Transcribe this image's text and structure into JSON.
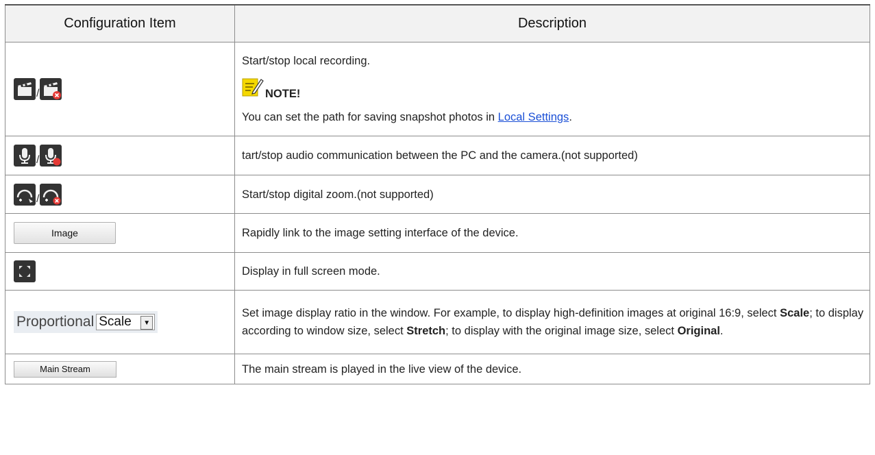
{
  "headers": {
    "col1": "Configuration Item",
    "col2": "Description"
  },
  "rows": [
    {
      "icon_pair": [
        "record-start-icon",
        "record-stop-icon"
      ],
      "line1": "Start/stop local recording.",
      "note_label": "NOTE!",
      "note_text_before": "You can set the path for saving snapshot photos in ",
      "note_link": "Local Settings",
      "note_text_after": "."
    },
    {
      "icon_pair": [
        "mic-icon",
        "mic-stop-icon"
      ],
      "text": "tart/stop audio communication between the PC and the camera.(not supported)"
    },
    {
      "icon_pair": [
        "zoom-icon",
        "zoom-stop-icon"
      ],
      "text": "Start/stop digital zoom.(not supported)"
    },
    {
      "button_label": "Image",
      "text": "Rapidly link to the image setting interface of the device."
    },
    {
      "icon": "fullscreen-icon",
      "text": "Display in full screen mode."
    },
    {
      "control_label": "Proportional",
      "select_value": "Scale",
      "text_a": "Set image display ratio in the window. For example, to display high-definition images at original 16:9, select ",
      "bold_a": "Scale",
      "text_b": "; to display according to window size, select ",
      "bold_b": "Stretch",
      "text_c": "; to display with the original image size, select ",
      "bold_c": "Original",
      "text_d": "."
    },
    {
      "button_label": "Main Stream",
      "text": "The main stream is played in the live view of the device."
    }
  ],
  "colors": {
    "icon_bg": "#333333",
    "stop_badge": "#e53935",
    "link": "#1a4fd6",
    "note_icon": "#f5d800"
  }
}
